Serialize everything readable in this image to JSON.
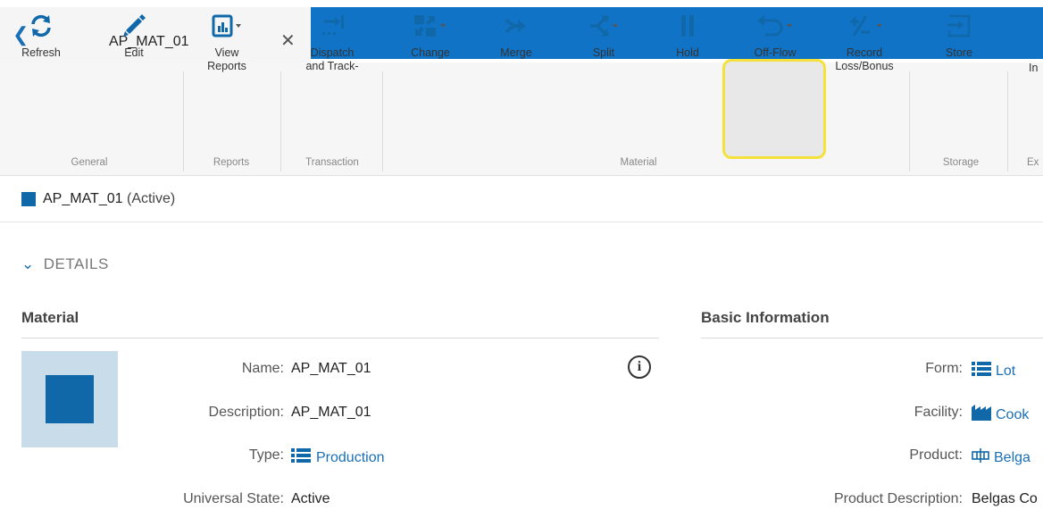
{
  "tab": {
    "title": "AP_MAT_01",
    "back_icon": "chevron-left-icon",
    "close_icon": "close-icon"
  },
  "ribbon": {
    "buttons": [
      {
        "label": "Refresh",
        "icon": "refresh-icon"
      },
      {
        "label": "Edit",
        "icon": "pencil-icon"
      },
      {
        "label": "View Reports",
        "icon": "report-icon"
      },
      {
        "label": "Dispatch and Track-",
        "icon": "dispatch-icon"
      },
      {
        "label": "Change",
        "icon": "change-icon"
      },
      {
        "label": "Merge",
        "icon": "merge-icon"
      },
      {
        "label": "Split",
        "icon": "split-icon"
      },
      {
        "label": "Hold",
        "icon": "pause-icon"
      },
      {
        "label": "Off-Flow",
        "icon": "undo-icon"
      },
      {
        "label": "Record Loss/Bonus",
        "icon": "plus-minus-icon"
      },
      {
        "label": "Store",
        "icon": "store-icon"
      },
      {
        "label": "In",
        "icon": ""
      }
    ],
    "groups": [
      "General",
      "Reports",
      "Transaction",
      "Material",
      "Storage",
      "Ex"
    ]
  },
  "entity": {
    "name": "AP_MAT_01",
    "status": "(Active)"
  },
  "details": {
    "heading": "DETAILS",
    "material": {
      "title": "Material",
      "name_label": "Name:",
      "name": "AP_MAT_01",
      "description_label": "Description:",
      "description": "AP_MAT_01",
      "type_label": "Type:",
      "type": "Production",
      "universal_state_label": "Universal State:",
      "universal_state": "Active"
    },
    "basic": {
      "title": "Basic Information",
      "form_label": "Form:",
      "form": "Lot",
      "facility_label": "Facility:",
      "facility": "Cook",
      "product_label": "Product:",
      "product": "Belga",
      "product_description_label": "Product Description:",
      "product_description": "Belgas Co"
    }
  },
  "colors": {
    "accent": "#1173c6",
    "brand_square": "#1068a9",
    "highlight": "#f5e13b"
  }
}
